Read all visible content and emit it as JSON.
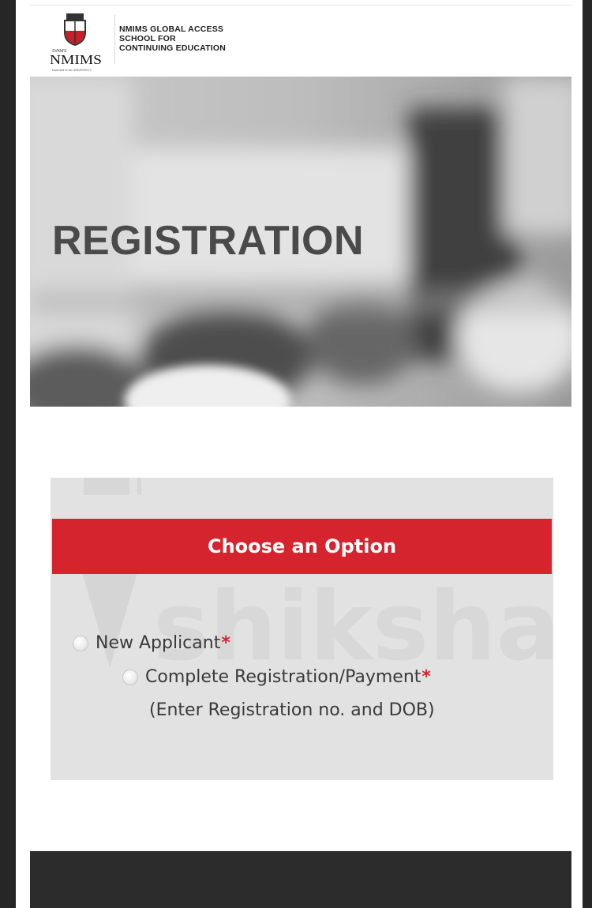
{
  "header": {
    "brand_name": "NMIMS",
    "brand_small_top": "SVKM'S",
    "brand_small_bottom": "Deemed to be UNIVERSITY",
    "school_line1": "NMIMS GLOBAL ACCESS",
    "school_line2": "SCHOOL FOR",
    "school_line3": "CONTINUING EDUCATION"
  },
  "hero": {
    "title": "REGISTRATION"
  },
  "options": {
    "header": "Choose an Option",
    "new_applicant_label": "New Applicant",
    "complete_registration_label": "Complete Registration/Payment",
    "required_mark": "*",
    "hint": "(Enter Registration no. and DOB)"
  },
  "watermark": {
    "text": "shiksha"
  },
  "colors": {
    "accent": "#d5242e",
    "panel": "#e2e2e2",
    "frame": "#262626"
  }
}
